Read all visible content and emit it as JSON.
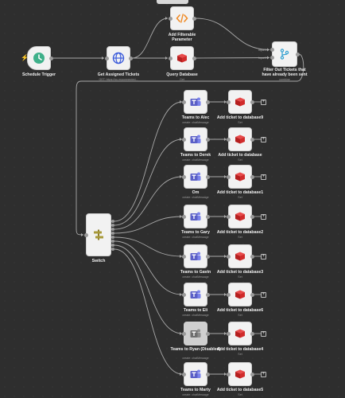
{
  "colors": {
    "background": "#2e2e2e",
    "edge": "#a8a8a8",
    "node_bg": "#f2f2f2",
    "teams": "#5a5fc7",
    "redis": "#d12b2b",
    "trigger": "#3fb08a",
    "http": "#3b5bdb"
  },
  "trigger": {
    "label": "Schedule Trigger",
    "icon": "clock-icon"
  },
  "get_tickets": {
    "label": "Get Assigned Tickets",
    "sub": "GET: https://su.myconnected...",
    "icon": "globe-icon"
  },
  "filter_param": {
    "label_line1": "Add Filterable",
    "label_line2": "Parameter",
    "icon": "code-icon"
  },
  "query_db": {
    "label": "Query Database",
    "sub": "Get",
    "icon": "redis-icon"
  },
  "filter_out": {
    "label_line1": "Filter Out Tickets that",
    "label_line2": "have already been sent",
    "sub": "combine",
    "input1": "Input 1",
    "input2": "Input 2",
    "icon": "merge-icon"
  },
  "switch": {
    "label": "Switch",
    "icon": "switch-icon"
  },
  "rows": [
    {
      "teams": "Teams to Alec",
      "teams_sub": "create: chatMessage",
      "db": "Add ticket to database9",
      "db_sub": "Set"
    },
    {
      "teams": "Teams to Derek",
      "teams_sub": "create: chatMessage",
      "db": "Add ticket to database",
      "db_sub": "Set"
    },
    {
      "teams": "Om",
      "teams_sub": "create: chatMessage",
      "db": "Add ticket to database1",
      "db_sub": "Set"
    },
    {
      "teams": "Teams to Gary",
      "teams_sub": "create: chatMessage",
      "db": "Add ticket to database2",
      "db_sub": "Set"
    },
    {
      "teams": "Teams to Gavin",
      "teams_sub": "create: chatMessage",
      "db": "Add ticket to database3",
      "db_sub": "Set"
    },
    {
      "teams": "Teams to Eli",
      "teams_sub": "create: chatMessage",
      "db": "Add ticket to database6",
      "db_sub": "Set"
    },
    {
      "teams": "Teams to Ryan (Disabled)",
      "teams_sub": "create: chatMessage",
      "db": "Add ticket to database4",
      "db_sub": "Set",
      "disabled": true
    },
    {
      "teams": "Teams to Marty",
      "teams_sub": "create: chatMessage",
      "db": "Add ticket to database5",
      "db_sub": "Set"
    }
  ],
  "add_symbol": "+"
}
